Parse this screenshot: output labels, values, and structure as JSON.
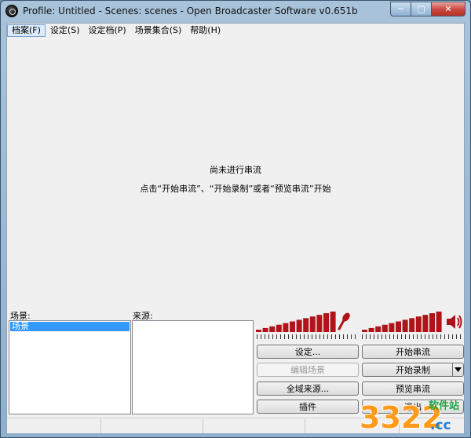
{
  "window": {
    "title": "Profile: Untitled - Scenes: scenes - Open Broadcaster Software v0.651b",
    "app_icon": "obs-logo-icon"
  },
  "caption_buttons": {
    "minimize": "─",
    "maximize": "□",
    "close": "✕"
  },
  "menu": {
    "items": [
      {
        "label": "档案(F)"
      },
      {
        "label": "设定(S)"
      },
      {
        "label": "设定档(P)"
      },
      {
        "label": "场景集合(S)"
      },
      {
        "label": "帮助(H)"
      }
    ]
  },
  "preview": {
    "line1": "尚未进行串流",
    "line2": "点击“开始串流”、“开始录制”或者“预览串流”开始"
  },
  "scenes": {
    "label": "场景:",
    "items": [
      "场景"
    ]
  },
  "sources": {
    "label": "来源:"
  },
  "audio": {
    "mic_icon": "microphone-icon",
    "speaker_icon": "speaker-icon",
    "meter_color": "#b0141a"
  },
  "buttons": {
    "settings": "设定...",
    "edit_scene": "编辑场景",
    "global_sources": "全域来源...",
    "plugins": "插件",
    "start_streaming": "开始串流",
    "start_recording": "开始录制",
    "preview_stream": "预览串流",
    "exit": "退出"
  },
  "watermark": {
    "number": "3322",
    "text": "软件站",
    "suffix": ".cc"
  }
}
